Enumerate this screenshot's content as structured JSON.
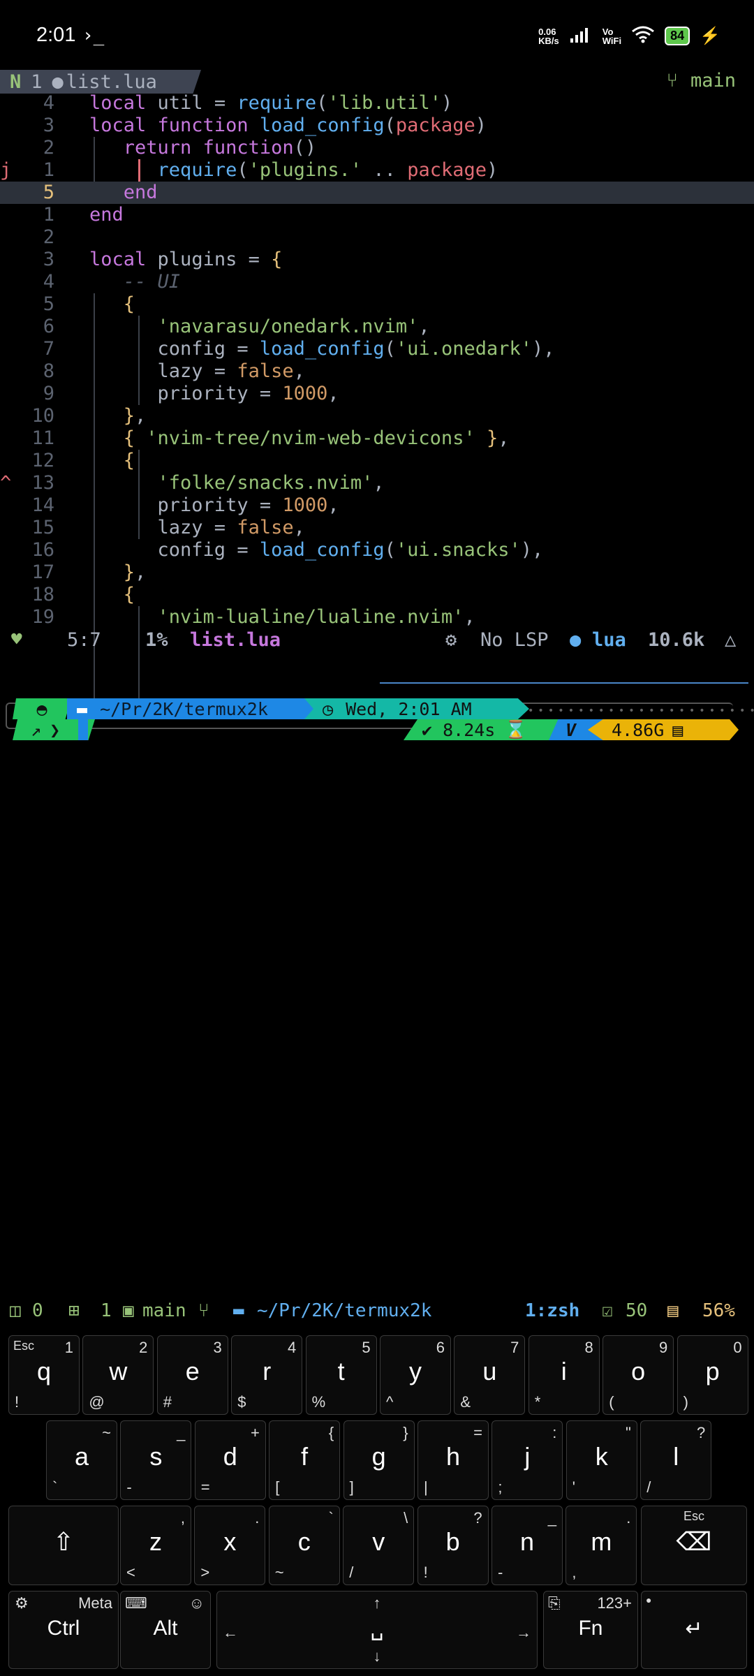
{
  "status_bar": {
    "time": "2:01",
    "terminal_glyph": "›_",
    "net_speed": "0.06\nKB/s",
    "volte": "Vo\nWiFi",
    "battery": "84"
  },
  "tabline": {
    "buffer_num": "1",
    "file_name": "list.lua",
    "branch": "main"
  },
  "code_lines": [
    {
      "num": "4",
      "mark": "",
      "tokens": [
        [
          "kw",
          "local "
        ],
        [
          "pun",
          "util = "
        ],
        [
          "fn",
          "require"
        ],
        [
          "pun",
          "("
        ],
        [
          "str",
          "'lib.util'"
        ],
        [
          "pun",
          ")"
        ]
      ]
    },
    {
      "num": "3",
      "mark": "",
      "tokens": [
        [
          "kw",
          "local function "
        ],
        [
          "fn",
          "load_config"
        ],
        [
          "pun",
          "("
        ],
        [
          "var",
          "package"
        ],
        [
          "pun",
          ")"
        ]
      ]
    },
    {
      "num": "2",
      "mark": "",
      "tokens": [
        [
          "pun",
          "   "
        ],
        [
          "kw",
          "return function"
        ],
        [
          "pun",
          "()"
        ]
      ]
    },
    {
      "num": "1",
      "mark": "j",
      "tokens": [
        [
          "pun",
          "      "
        ],
        [
          "fn",
          "require"
        ],
        [
          "pun",
          "("
        ],
        [
          "str",
          "'plugins.'"
        ],
        [
          "pun",
          " .. "
        ],
        [
          "var",
          "package"
        ],
        [
          "pun",
          ")"
        ]
      ]
    },
    {
      "num": "5",
      "mark": "",
      "current": true,
      "tokens": [
        [
          "pun",
          "   "
        ],
        [
          "kw",
          "end"
        ]
      ]
    },
    {
      "num": "1",
      "mark": "",
      "tokens": [
        [
          "kw",
          "end"
        ]
      ]
    },
    {
      "num": "2",
      "mark": "",
      "tokens": []
    },
    {
      "num": "3",
      "mark": "",
      "tokens": [
        [
          "kw",
          "local "
        ],
        [
          "pun",
          "plugins = "
        ],
        [
          "br",
          "{"
        ]
      ]
    },
    {
      "num": "4",
      "mark": "",
      "tokens": [
        [
          "pun",
          "   "
        ],
        [
          "cm",
          "-- UI"
        ]
      ]
    },
    {
      "num": "5",
      "mark": "",
      "tokens": [
        [
          "pun",
          "   "
        ],
        [
          "br",
          "{"
        ]
      ]
    },
    {
      "num": "6",
      "mark": "",
      "tokens": [
        [
          "pun",
          "      "
        ],
        [
          "str",
          "'navarasu/onedark.nvim'"
        ],
        [
          "pun",
          ","
        ]
      ]
    },
    {
      "num": "7",
      "mark": "",
      "tokens": [
        [
          "pun",
          "      config = "
        ],
        [
          "fn",
          "load_config"
        ],
        [
          "pun",
          "("
        ],
        [
          "str",
          "'ui.onedark'"
        ],
        [
          "pun",
          "),"
        ]
      ]
    },
    {
      "num": "8",
      "mark": "",
      "tokens": [
        [
          "pun",
          "      lazy = "
        ],
        [
          "num",
          "false"
        ],
        [
          "pun",
          ","
        ]
      ]
    },
    {
      "num": "9",
      "mark": "",
      "tokens": [
        [
          "pun",
          "      priority = "
        ],
        [
          "num",
          "1000"
        ],
        [
          "pun",
          ","
        ]
      ]
    },
    {
      "num": "10",
      "mark": "",
      "tokens": [
        [
          "pun",
          "   "
        ],
        [
          "br",
          "}"
        ],
        [
          "pun",
          ","
        ]
      ]
    },
    {
      "num": "11",
      "mark": "",
      "tokens": [
        [
          "pun",
          "   "
        ],
        [
          "br",
          "{ "
        ],
        [
          "str",
          "'nvim-tree/nvim-web-devicons'"
        ],
        [
          "br",
          " }"
        ],
        [
          "pun",
          ","
        ]
      ]
    },
    {
      "num": "12",
      "mark": "",
      "tokens": [
        [
          "pun",
          "   "
        ],
        [
          "br",
          "{"
        ]
      ]
    },
    {
      "num": "13",
      "mark": "^",
      "tokens": [
        [
          "pun",
          "      "
        ],
        [
          "str",
          "'folke/snacks.nvim'"
        ],
        [
          "pun",
          ","
        ]
      ]
    },
    {
      "num": "14",
      "mark": "",
      "tokens": [
        [
          "pun",
          "      priority = "
        ],
        [
          "num",
          "1000"
        ],
        [
          "pun",
          ","
        ]
      ]
    },
    {
      "num": "15",
      "mark": "",
      "tokens": [
        [
          "pun",
          "      lazy = "
        ],
        [
          "num",
          "false"
        ],
        [
          "pun",
          ","
        ]
      ]
    },
    {
      "num": "16",
      "mark": "",
      "tokens": [
        [
          "pun",
          "      config = "
        ],
        [
          "fn",
          "load_config"
        ],
        [
          "pun",
          "("
        ],
        [
          "str",
          "'ui.snacks'"
        ],
        [
          "pun",
          "),"
        ]
      ]
    },
    {
      "num": "17",
      "mark": "",
      "tokens": [
        [
          "pun",
          "   "
        ],
        [
          "br",
          "}"
        ],
        [
          "pun",
          ","
        ]
      ]
    },
    {
      "num": "18",
      "mark": "",
      "tokens": [
        [
          "pun",
          "   "
        ],
        [
          "br",
          "{"
        ]
      ]
    },
    {
      "num": "19",
      "mark": "",
      "tokens": [
        [
          "pun",
          "      "
        ],
        [
          "str",
          "'nvim-lualine/lualine.nvim'"
        ],
        [
          "pun",
          ","
        ]
      ]
    }
  ],
  "statusline": {
    "position": "5:7",
    "percent": "1%",
    "file": "list.lua",
    "lsp": "No LSP",
    "filetype": "lua",
    "size": "10.6k"
  },
  "prompt": {
    "path": "~/Pr/2K/termux2k",
    "clock": "Wed, 2:01 AM",
    "duration": "✔ 8.24s",
    "vlabel": "V",
    "memory": "4.86G"
  },
  "tmux_bar": {
    "panes": "0",
    "windows": "1",
    "session": "main",
    "path": "~/Pr/2K/termux2k",
    "window": "1:zsh",
    "tasks": "50",
    "mem_pct": "56%"
  },
  "keyboard": {
    "row1": [
      [
        "q",
        "1",
        "!",
        "Esc"
      ],
      [
        "w",
        "2",
        "@",
        ""
      ],
      [
        "e",
        "3",
        "#",
        ""
      ],
      [
        "r",
        "4",
        "$",
        ""
      ],
      [
        "t",
        "5",
        "%",
        ""
      ],
      [
        "y",
        "6",
        "^",
        ""
      ],
      [
        "u",
        "7",
        "&",
        ""
      ],
      [
        "i",
        "8",
        "*",
        ""
      ],
      [
        "o",
        "9",
        "(",
        ""
      ],
      [
        "p",
        "0",
        ")",
        ""
      ]
    ],
    "row2": [
      [
        "a",
        "~",
        "`"
      ],
      [
        "s",
        "_",
        "-"
      ],
      [
        "d",
        "+",
        "="
      ],
      [
        "f",
        "{",
        "["
      ],
      [
        "g",
        "}",
        "]"
      ],
      [
        "h",
        "=",
        "|"
      ],
      [
        "j",
        ":",
        ";"
      ],
      [
        "k",
        "\"",
        "'"
      ],
      [
        "l",
        "?",
        "/"
      ]
    ],
    "row3": [
      [
        "z",
        ",",
        "<"
      ],
      [
        "x",
        ".",
        ">"
      ],
      [
        "c",
        "`",
        "~"
      ],
      [
        "v",
        "\\",
        "/"
      ],
      [
        "b",
        "?",
        "!"
      ],
      [
        "n",
        "_",
        "-"
      ],
      [
        "m",
        ".",
        ","
      ]
    ],
    "shift": "⇧",
    "esc_label": "Esc",
    "ctrl": "Ctrl",
    "meta": "Meta",
    "alt": "Alt",
    "fn": "Fn",
    "num_switch": "123+",
    "enter": "↵"
  },
  "colors": {
    "accent_green": "#98c379",
    "accent_blue": "#61afef",
    "accent_yellow": "#e5c07b",
    "accent_purple": "#c678dd",
    "accent_red": "#e06c75"
  }
}
